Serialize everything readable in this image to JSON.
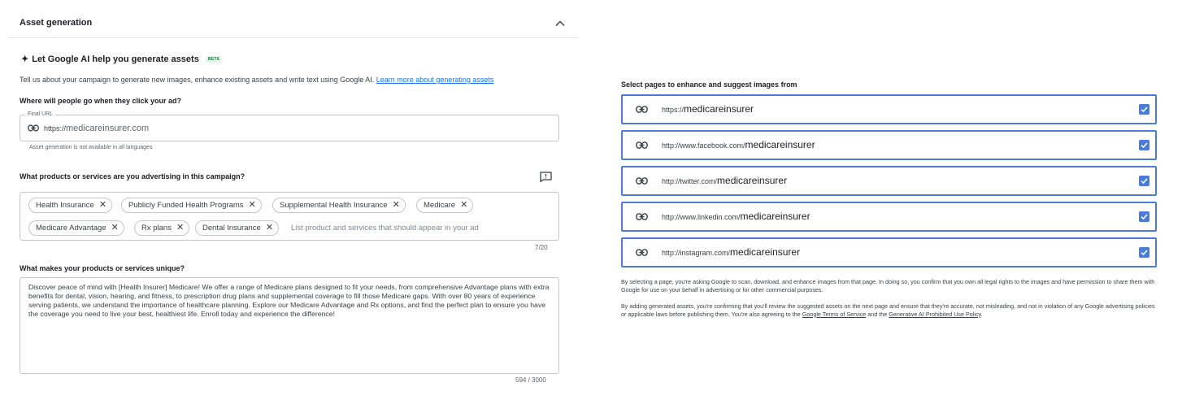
{
  "asset_generation": {
    "title": "Asset generation",
    "ai_title": "Let Google AI help you generate assets",
    "beta_label": "BETA",
    "intro_text": "Tell us about your campaign to generate new images, enhance existing assets and write text using Google AI. ",
    "learn_more_link": "Learn more about generating assets"
  },
  "final_url": {
    "question": "Where will people go when they click your ad?",
    "label": "Final URL",
    "prefix": "https://",
    "domain": "medicareinsurer.com",
    "help_text": "Asset generation is not available in all languages"
  },
  "products": {
    "question": "What products or services are you advertising in this campaign?",
    "chips": [
      "Health Insurance",
      "Publicly Funded Health Programs",
      "Supplemental Health Insurance",
      "Medicare",
      "Medicare Advantage",
      "Rx plans",
      "Dental Insurance"
    ],
    "placeholder": "List product and services that should appear in your ad",
    "count": "7/20"
  },
  "unique": {
    "question": "What makes your products or services unique?",
    "description": "Discover peace of mind with [Health Insurer] Medicare! We offer a range of Medicare plans designed to fit your needs, from comprehensive Advantage plans with extra benefits for dental, vision, hearing, and fitness, to prescription drug plans and supplemental coverage to fill those Medicare gaps. With over 80 years of experience serving patients, we understand the importance of healthcare planning. Explore our Medicare Advantage and Rx options, and find the perfect plan to ensure you have the coverage you need to live your best, healthiest life. Enroll today and experience the difference!",
    "count": "594 / 3000"
  },
  "pages": {
    "title": "Select pages to enhance and suggest images from",
    "rows": [
      {
        "prefix": "https://",
        "handle": "medicareinsurer",
        "checked": true
      },
      {
        "prefix": "http://www.facebook.com/",
        "handle": "medicareinsurer",
        "checked": true
      },
      {
        "prefix": "http://twitter.com/",
        "handle": "medicareinsurer",
        "checked": true
      },
      {
        "prefix": "http://www.linkedin.com/",
        "handle": "medicareinsurer",
        "checked": true
      },
      {
        "prefix": "http://instagram.com/",
        "handle": "medicareinsurer",
        "checked": true
      }
    ],
    "disclaimer1": "By selecting a page, you're asking Google to scan, download, and enhance images from that page. In doing so, you confirm that you own all legal rights to the images and have permission to share them with Google for use on your behalf in advertising or for other commercial purposes.",
    "disclaimer2_text": "By adding generated assets, you're confirming that you'll review the suggested assets on the next page and ensure that they're accurate, not misleading, and not in violation of any Google advertising policies or applicable laws before publishing them. You're also agreeing to the ",
    "terms_link": "Google Terms of Service",
    "and_text": " and the ",
    "policy_link": "Generative AI Prohibited Use Policy",
    "end_text": "."
  },
  "colors": {
    "accent_blue": "#4c7bd9",
    "link_blue": "#1a73e8",
    "beta_green": "#188038"
  }
}
